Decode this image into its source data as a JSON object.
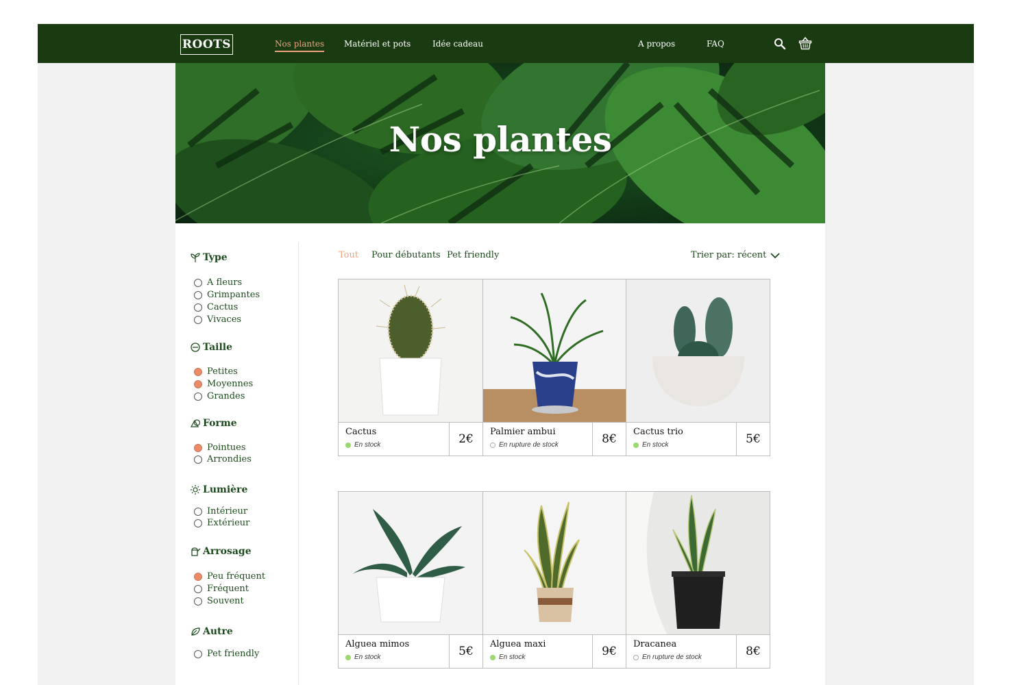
{
  "header": {
    "logo": "ROOTS",
    "nav_left": [
      "Nos plantes",
      "Matériel et pots",
      "Idée cadeau"
    ],
    "nav_right": [
      "A propos",
      "FAQ"
    ],
    "active_nav": "Nos plantes",
    "icons": [
      "search-icon",
      "basket-icon"
    ],
    "background_color": "#1a3a12",
    "accent_color": "#f0a27c"
  },
  "hero": {
    "title": "Nos plantes"
  },
  "filters": {
    "type": {
      "title": "Type",
      "options": [
        {
          "label": "A fleurs",
          "checked": false
        },
        {
          "label": "Grimpantes",
          "checked": false
        },
        {
          "label": "Cactus",
          "checked": false
        },
        {
          "label": "Vivaces",
          "checked": false
        }
      ]
    },
    "taille": {
      "title": "Taille",
      "options": [
        {
          "label": "Petites",
          "checked": true
        },
        {
          "label": "Moyennes",
          "checked": true
        },
        {
          "label": "Grandes",
          "checked": false
        }
      ]
    },
    "forme": {
      "title": "Forme",
      "options": [
        {
          "label": "Pointues",
          "checked": true
        },
        {
          "label": "Arrondies",
          "checked": false
        }
      ]
    },
    "lumiere": {
      "title": "Lumière",
      "options": [
        {
          "label": "Intérieur",
          "checked": false
        },
        {
          "label": "Extérieur",
          "checked": false
        }
      ]
    },
    "arrosage": {
      "title": "Arrosage",
      "options": [
        {
          "label": "Peu fréquent",
          "checked": true
        },
        {
          "label": "Fréquent",
          "checked": false
        },
        {
          "label": "Souvent",
          "checked": false
        }
      ]
    },
    "autre": {
      "title": "Autre",
      "options": [
        {
          "label": "Pet friendly",
          "checked": false
        }
      ]
    }
  },
  "tabs": {
    "all": "Tout",
    "beginners": "Pour débutants",
    "pet": "Pet friendly",
    "active": "Tout"
  },
  "sort": {
    "label": "Trier par: récent"
  },
  "products": [
    {
      "name": "Cactus",
      "stock": "En stock",
      "in_stock": true,
      "price": "2€"
    },
    {
      "name": "Palmier ambui",
      "stock": "En rupture de stock",
      "in_stock": false,
      "price": "8€"
    },
    {
      "name": "Cactus trio",
      "stock": "En stock",
      "in_stock": true,
      "price": "5€"
    },
    {
      "name": "Alguea mimos",
      "stock": "En stock",
      "in_stock": true,
      "price": "5€"
    },
    {
      "name": "Alguea maxi",
      "stock": "En stock",
      "in_stock": true,
      "price": "9€"
    },
    {
      "name": "Dracanea",
      "stock": "En rupture de stock",
      "in_stock": false,
      "price": "8€"
    }
  ],
  "colors": {
    "checked_radio": "#ec8a68",
    "in_stock_dot": "#9bd86f",
    "text_green": "#1d4a1d"
  }
}
